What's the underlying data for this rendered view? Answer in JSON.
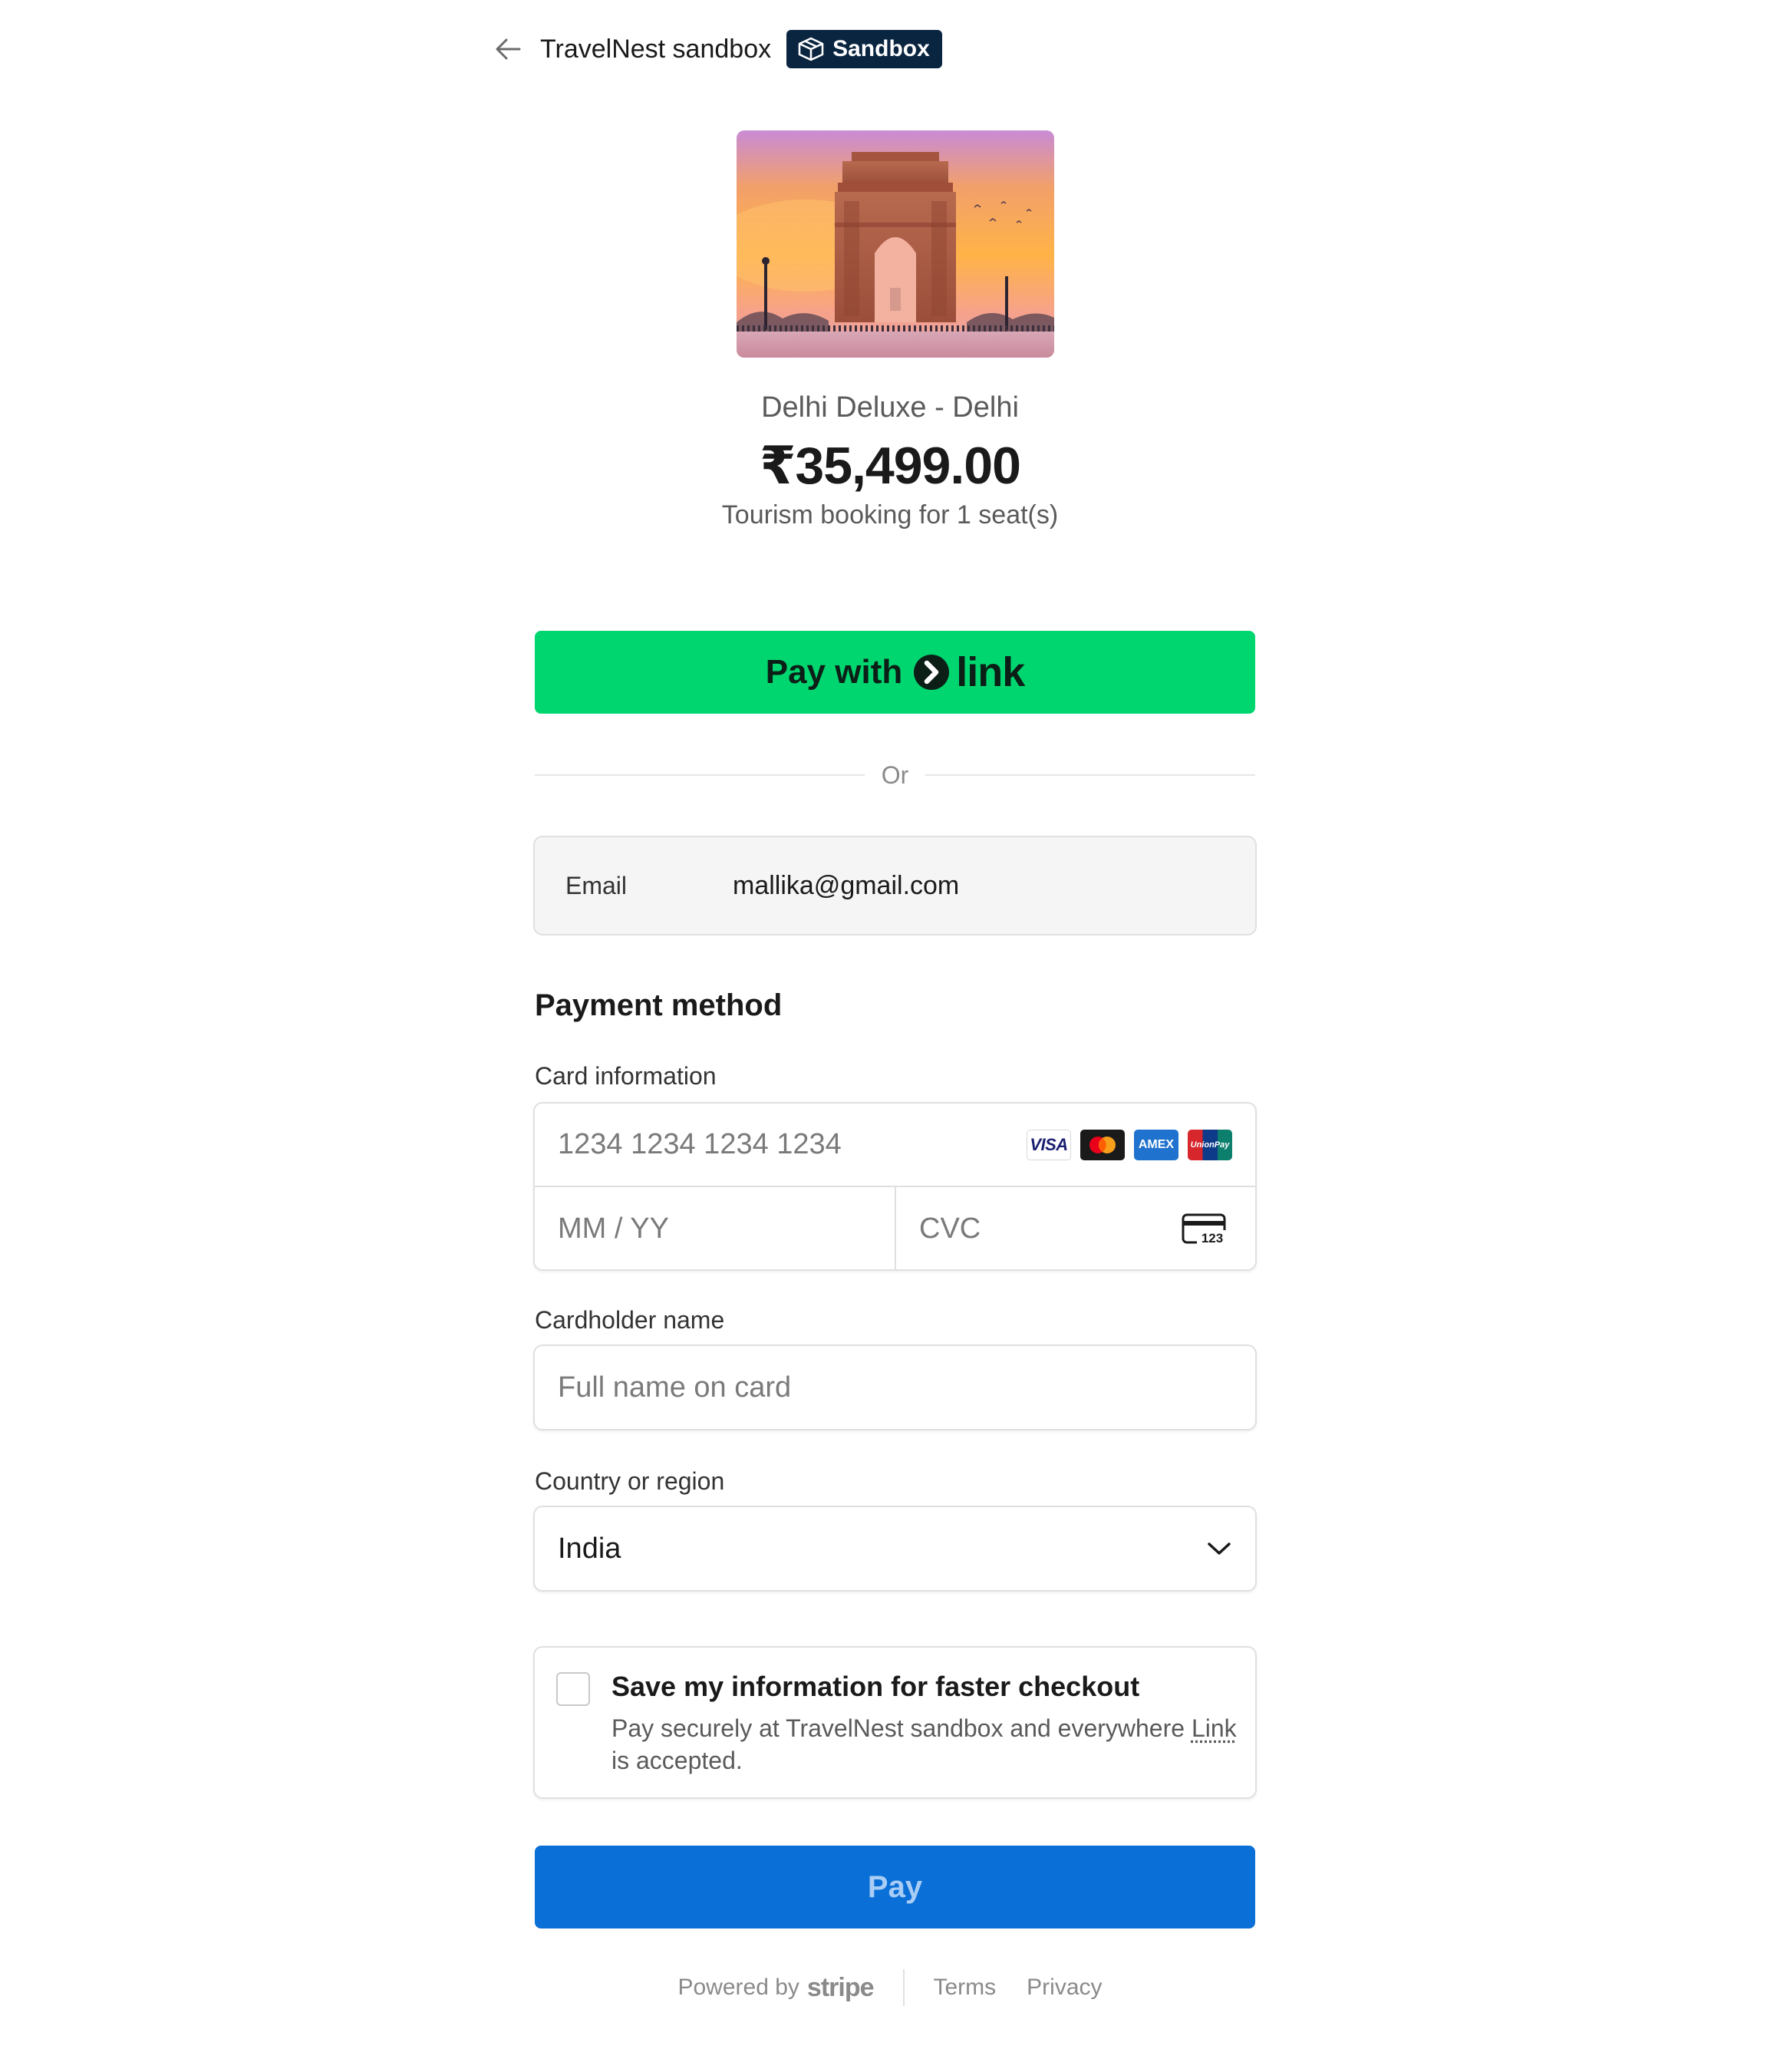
{
  "header": {
    "merchant_name": "TravelNest sandbox",
    "badge_label": "Sandbox"
  },
  "product": {
    "image_icon": "india-gate-photo",
    "name": "Delhi Deluxe - Delhi",
    "price": "₹35,499.00",
    "description": "Tourism booking for 1 seat(s)"
  },
  "link_button": {
    "prefix": "Pay with",
    "brand": "link"
  },
  "divider": {
    "text": "Or"
  },
  "email": {
    "label": "Email",
    "value": "mallika@gmail.com"
  },
  "payment": {
    "title": "Payment method",
    "card_label": "Card information",
    "card_number_placeholder": "1234 1234 1234 1234",
    "brands": [
      "VISA",
      "mastercard",
      "AMEX",
      "UnionPay"
    ],
    "expiry_placeholder": "MM / YY",
    "cvc_placeholder": "CVC",
    "cvc_icon_text": "123",
    "cardholder_label": "Cardholder name",
    "cardholder_placeholder": "Full name on card",
    "country_label": "Country or region",
    "country_value": "India"
  },
  "save_info": {
    "checked": false,
    "title": "Save my information for faster checkout",
    "desc_before": "Pay securely at TravelNest sandbox and everywhere ",
    "desc_link": "Link",
    "desc_after": " is accepted."
  },
  "pay_button": {
    "label": "Pay"
  },
  "footer": {
    "powered_by": "Powered by",
    "stripe": "stripe",
    "terms": "Terms",
    "privacy": "Privacy"
  },
  "colors": {
    "link_green": "#00d66f",
    "pay_blue": "#0a6fd6",
    "sandbox_badge": "#0a2540"
  }
}
